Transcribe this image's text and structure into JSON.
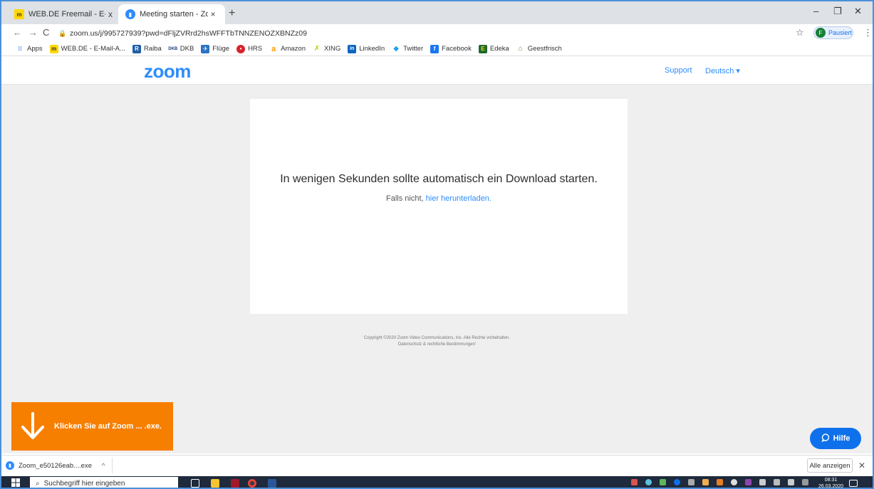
{
  "browser": {
    "tabs": [
      {
        "title": "WEB.DE Freemail - E-Mail made i",
        "close": "x"
      },
      {
        "title": "Meeting starten - Zoom",
        "close": "×"
      }
    ],
    "new_tab": "+",
    "window_controls": {
      "minimize": "–",
      "restore": "❐",
      "close": "✕"
    },
    "url": "zoom.us/j/995727939?pwd=dFljZVRrd2hsWFFTbTNNZENOZXBNZz09",
    "profile": {
      "initial": "F",
      "label": "Pausiert"
    }
  },
  "bookmarks": [
    {
      "label": "Apps",
      "icon": "apps-grid-icon",
      "color": "#4285f4",
      "glyph": "⋮⋮"
    },
    {
      "label": "WEB.DE - E-Mail-A...",
      "icon": "webde-icon",
      "color": "#ffd800",
      "glyph": "m"
    },
    {
      "label": "Raiba",
      "icon": "raiba-icon",
      "color": "#1f5fa8",
      "glyph": "R"
    },
    {
      "label": "DKB",
      "icon": "dkb-icon",
      "color": "#1a3e7a",
      "glyph": "DKB"
    },
    {
      "label": "Flüge",
      "icon": "flights-icon",
      "color": "#2b73c2",
      "glyph": "✈"
    },
    {
      "label": "HRS",
      "icon": "hrs-icon",
      "color": "#d8232a",
      "glyph": "●"
    },
    {
      "label": "Amazon",
      "icon": "amazon-icon",
      "color": "#ff9900",
      "glyph": "a"
    },
    {
      "label": "XING",
      "icon": "xing-icon",
      "color": "#026466",
      "glyph": "X"
    },
    {
      "label": "LinkedIn",
      "icon": "linkedin-icon",
      "color": "#0a66c2",
      "glyph": "in"
    },
    {
      "label": "Twitter",
      "icon": "twitter-icon",
      "color": "#1da1f2",
      "glyph": "🐦"
    },
    {
      "label": "Facebook",
      "icon": "facebook-icon",
      "color": "#1877f2",
      "glyph": "f"
    },
    {
      "label": "Edeka",
      "icon": "edeka-icon",
      "color": "#ffd500",
      "glyph": "E"
    },
    {
      "label": "Geestfrisch",
      "icon": "geestfrisch-icon",
      "color": "#5c9a3a",
      "glyph": "⌂"
    }
  ],
  "zoom_header": {
    "logo": "zoom",
    "support": "Support",
    "language": "Deutsch ▾",
    "brand_color": "#2d8cff"
  },
  "main": {
    "headline": "In wenigen Sekunden sollte automatisch ein Download starten.",
    "sub_prefix": "Falls nicht, ",
    "download_link": "hier herunterladen.",
    "copyright": "Copyright ©2020 Zoom Video Communications, Inc. Alle Rechte vorbehalten.",
    "privacy": "Datenschutz & rechtliche Bestimmungen'"
  },
  "hint": {
    "text": "Klicken Sie auf Zoom ... .exe.",
    "color": "#f77f00"
  },
  "help_button": {
    "label": "Hilfe",
    "color": "#0e71eb"
  },
  "download_shelf": {
    "filename": "Zoom_e50126eab....exe",
    "caret": "^",
    "show_all": "Alle anzeigen",
    "close": "✕"
  },
  "taskbar": {
    "search_placeholder": "Suchbegriff hier eingeben",
    "time": "08:31",
    "date": "26.03.2020"
  }
}
